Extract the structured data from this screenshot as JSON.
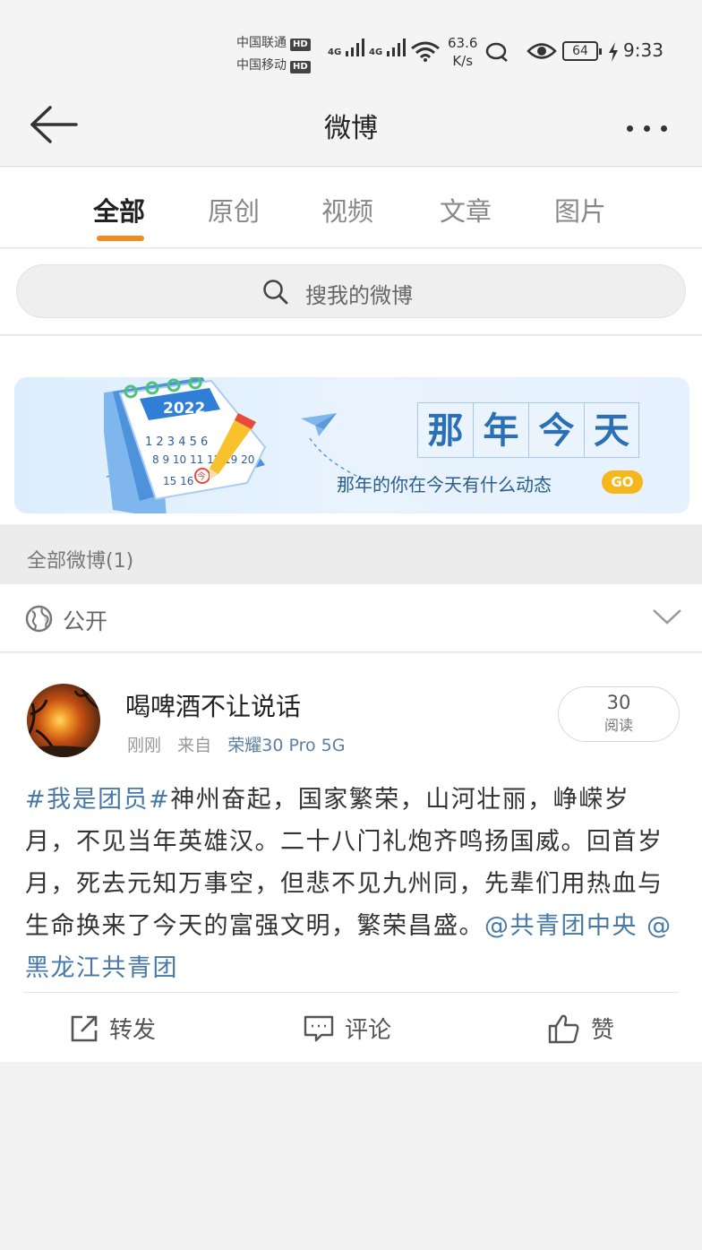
{
  "status_bar": {
    "carrier1": "中国联通",
    "carrier2": "中国移动",
    "hd": "HD",
    "net1": "4G",
    "net2": "4G",
    "speed_value": "63.6",
    "speed_unit": "K/s",
    "battery": "64",
    "time": "9:33"
  },
  "nav": {
    "title": "微博"
  },
  "tabs": [
    {
      "label": "全部",
      "active": true
    },
    {
      "label": "原创",
      "active": false
    },
    {
      "label": "视频",
      "active": false
    },
    {
      "label": "文章",
      "active": false
    },
    {
      "label": "图片",
      "active": false
    }
  ],
  "search": {
    "placeholder": "搜我的微博"
  },
  "banner": {
    "year": "2022",
    "calendar_rows": [
      "1 2 3 4 5 6",
      "8 9 10 11 12",
      "15 16"
    ],
    "calendar_today": "今",
    "calendar_extra": "19 20",
    "title_chars": [
      "那",
      "年",
      "今",
      "天"
    ],
    "subtitle": "那年的你在今天有什么动态",
    "go": "GO"
  },
  "section": {
    "header": "全部微博(1)"
  },
  "filter": {
    "label": "公开"
  },
  "post": {
    "author": "喝啤酒不让说话",
    "time": "刚刚",
    "from_label": "来自",
    "source": "荣耀30 Pro 5G",
    "reads_count": "30",
    "reads_label": "阅读",
    "hashtag": "#我是团员#",
    "text": "神州奋起，国家繁荣，山河壮丽，峥嵘岁月，不见当年英雄汉。二十八门礼炮齐鸣扬国威。回首岁月，死去元知万事空，但悲不见九州同，先辈们用热血与生命换来了今天的富强文明，繁荣昌盛。",
    "mention1": "@共青团中央",
    "mention2": "@黑龙江共青团",
    "actions": {
      "repost": "转发",
      "comment": "评论",
      "like": "赞"
    }
  },
  "colors": {
    "accent": "#f28a1d",
    "link": "#4779a8",
    "banner_blue": "#2b6fb5",
    "go": "#f5b71c"
  }
}
